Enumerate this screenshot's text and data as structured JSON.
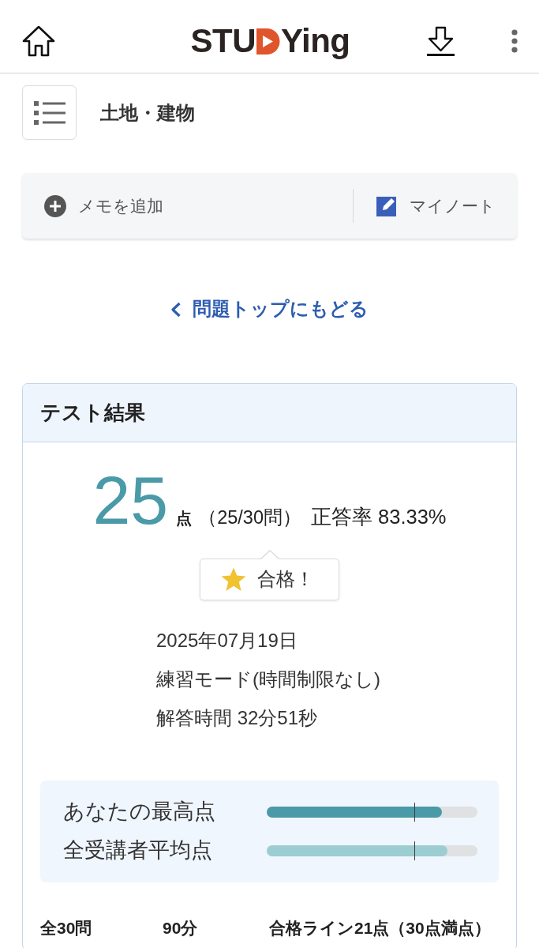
{
  "header": {
    "logo": {
      "left": "STU",
      "right": "Ying"
    }
  },
  "topic": {
    "title": "土地・建物"
  },
  "memo_bar": {
    "add_memo": "メモを追加",
    "my_note": "マイノート"
  },
  "back_link": "問題トップにもどる",
  "result_card": {
    "title": "テスト結果",
    "score": "25",
    "score_unit": "点",
    "count": "（25/30問）",
    "rate": "正答率 83.33%",
    "badge": {
      "label": "合格！"
    },
    "details": [
      "2025年07月19日",
      "練習モード(時間制限なし)",
      "解答時間 32分51秒"
    ],
    "comparisons": [
      {
        "label": "あなたの最高点",
        "level": 0.833,
        "color": "#4a9aa8",
        "marker": {
          "level": 0.7
        }
      },
      {
        "label": "全受講者平均点",
        "level": 0.857,
        "color": "#9ccdd3",
        "marker": {
          "level": 0.7
        }
      }
    ],
    "footer": [
      "全30問",
      "90分",
      "合格ライン21点（30点満点）"
    ]
  }
}
